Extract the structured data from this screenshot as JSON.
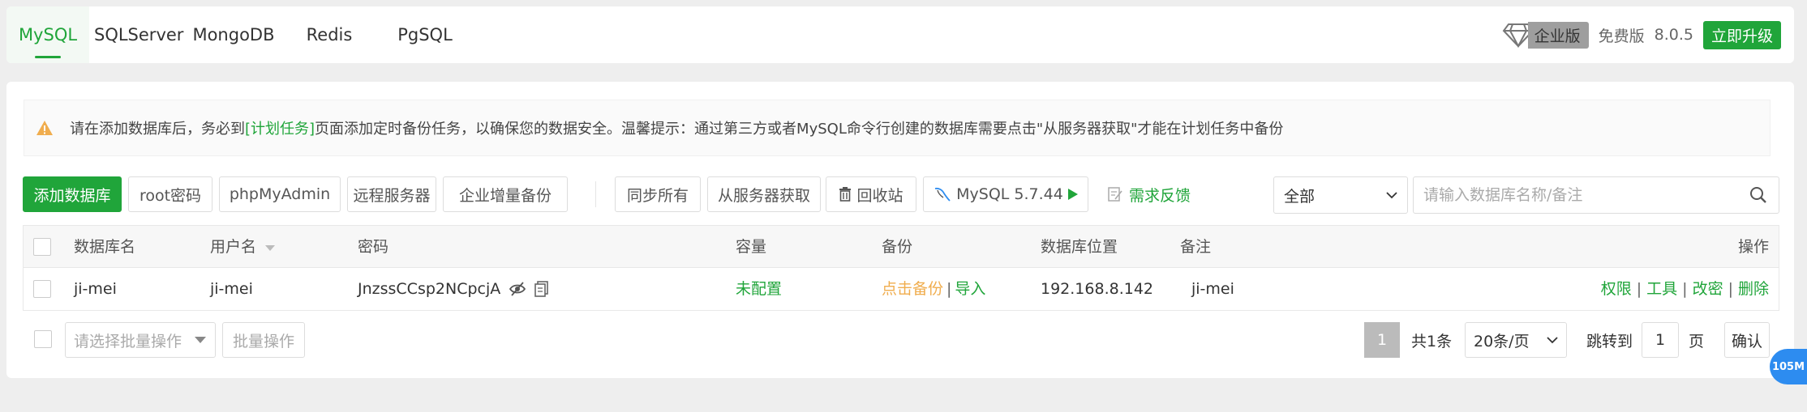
{
  "tabs": [
    {
      "label": "MySQL",
      "active": true
    },
    {
      "label": "SQLServer",
      "active": false
    },
    {
      "label": "MongoDB",
      "active": false
    },
    {
      "label": "Redis",
      "active": false
    },
    {
      "label": "PgSQL",
      "active": false
    }
  ],
  "header": {
    "edition_badge": "企业版",
    "free_label": "免费版",
    "version": "8.0.5",
    "upgrade_label": "立即升级",
    "upgrade_icon": "diamond-icon"
  },
  "notice": {
    "icon": "warning-icon",
    "text_before": "请在添加数据库后，务必到",
    "link": "[计划任务]",
    "text_after": "页面添加定时备份任务，以确保您的数据安全。温馨提示：通过第三方或者MySQL命令行创建的数据库需要点击\"从服务器获取\"才能在计划任务中备份"
  },
  "toolbar": {
    "add_db": "添加数据库",
    "root_pwd": "root密码",
    "phpmyadmin": "phpMyAdmin",
    "remote_server": "远程服务器",
    "ent_backup": "企业增量备份",
    "sync_all": "同步所有",
    "fetch_server": "从服务器获取",
    "recycle": "回收站",
    "mysql_version": "MySQL 5.7.44",
    "feedback": "需求反馈",
    "filter_selected": "全部",
    "search_placeholder": "请输入数据库名称/备注"
  },
  "table": {
    "headers": {
      "db_name": "数据库名",
      "username": "用户名",
      "password": "密码",
      "capacity": "容量",
      "backup": "备份",
      "location": "数据库位置",
      "remark": "备注",
      "actions": "操作"
    },
    "rows": [
      {
        "db_name": "ji-mei",
        "username": "ji-mei",
        "password": "JnzssCCsp2NCpcjA",
        "capacity": "未配置",
        "backup_action": "点击备份",
        "import_action": "导入",
        "location": "192.168.8.142",
        "remark": "ji-mei",
        "actions": [
          "权限",
          "工具",
          "改密",
          "删除"
        ]
      }
    ]
  },
  "footer": {
    "batch_placeholder": "请选择批量操作",
    "batch_button": "批量操作",
    "current_page": "1",
    "total": "共1条",
    "per_page": "20条/页",
    "jump_label": "跳转到",
    "jump_value": "1",
    "page_unit": "页",
    "confirm": "确认"
  },
  "float_badge": "105M",
  "colors": {
    "accent": "#20a53a",
    "warning": "#f0ad4e",
    "badge_blue": "#2d8cf0"
  }
}
